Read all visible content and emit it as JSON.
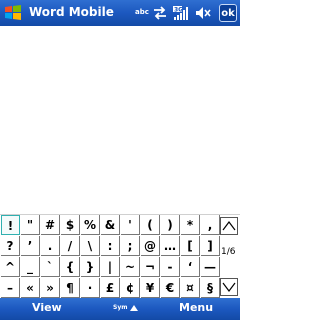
{
  "titlebar": {
    "app_title": "Word Mobile",
    "input_indicator": "abc",
    "ok_label": "ok",
    "status_icons": [
      "start-logo-icon",
      "connectivity-icon",
      "signal-3g-icon",
      "volume-mute-icon"
    ]
  },
  "keyboard": {
    "page_indicator": "1/6",
    "rows": [
      [
        "!",
        "\"",
        "#",
        "$",
        "%",
        "&",
        "'",
        "(",
        ")",
        "*",
        ","
      ],
      [
        "?",
        "’",
        ".",
        "/",
        "\\",
        ":",
        ";",
        "@",
        "…",
        "[",
        "]"
      ],
      [
        "^",
        "_",
        "`",
        "{",
        "}",
        "|",
        "~",
        "¬",
        "-",
        "‘",
        "—"
      ],
      [
        "–",
        "«",
        "»",
        "¶",
        "·",
        "£",
        "¢",
        "¥",
        "€",
        "¤",
        "§"
      ]
    ],
    "selected_key": "!"
  },
  "softkeys": {
    "left": "View",
    "center": "Sym",
    "right": "Menu"
  },
  "colors": {
    "bar_blue": "#1c58bf",
    "selected_border": "#30b0b0"
  }
}
